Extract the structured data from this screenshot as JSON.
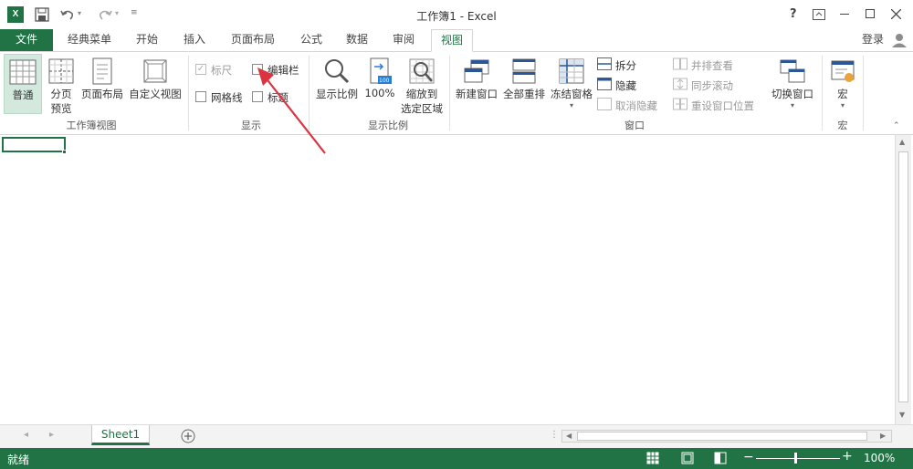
{
  "window": {
    "title": "工作簿1 - Excel",
    "help": "?",
    "login": "登录"
  },
  "tabs": {
    "file": "文件",
    "classic": "经典菜单",
    "home": "开始",
    "insert": "插入",
    "layout": "页面布局",
    "formulas": "公式",
    "data": "数据",
    "review": "审阅",
    "view": "视图"
  },
  "ribbon": {
    "views": {
      "normal": "普通",
      "page_break_1": "分页",
      "page_break_2": "预览",
      "page_layout": "页面布局",
      "custom": "自定义视图",
      "group": "工作簿视图"
    },
    "show": {
      "ruler": "标尺",
      "formula_bar": "编辑栏",
      "gridlines": "网格线",
      "headings": "标题",
      "group": "显示",
      "ruler_checked": true,
      "gridlines_checked": false,
      "formula_bar_checked": false,
      "headings_checked": false
    },
    "zoom": {
      "zoom": "显示比例",
      "hundred": "100%",
      "sel_1": "缩放到",
      "sel_2": "选定区域",
      "group": "显示比例"
    },
    "window": {
      "new_window": "新建窗口",
      "arrange_all": "全部重排",
      "freeze": "冻结窗格",
      "split": "拆分",
      "hide": "隐藏",
      "unhide": "取消隐藏",
      "side_by_side": "并排查看",
      "sync_scroll": "同步滚动",
      "reset_pos": "重设窗口位置",
      "switch": "切换窗口",
      "group": "窗口"
    },
    "macros": {
      "macro": "宏",
      "group": "宏"
    }
  },
  "sheets": {
    "tab1": "Sheet1"
  },
  "status": {
    "ready": "就绪",
    "zoom": "100%",
    "zoom_percent": 100
  },
  "colors": {
    "accent": "#217346",
    "arrow": "#d9343f"
  }
}
